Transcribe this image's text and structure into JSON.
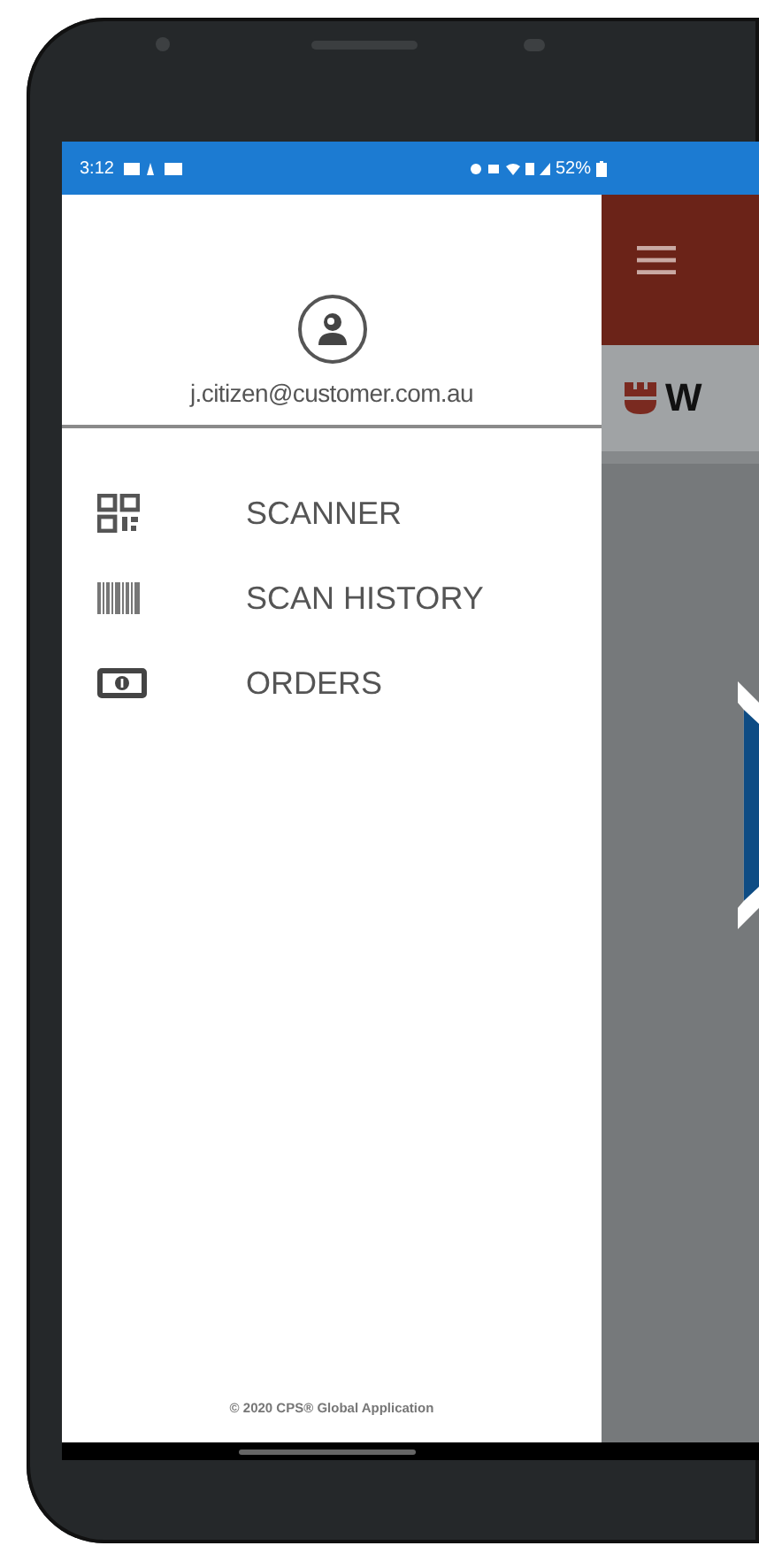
{
  "status_bar": {
    "time": "3:12",
    "battery": "52%"
  },
  "drawer": {
    "email": "j.citizen@customer.com.au",
    "items": [
      {
        "kind": "qr",
        "label": "SCANNER",
        "selected": false
      },
      {
        "kind": "barcode",
        "label": "SCAN HISTORY",
        "selected": false
      },
      {
        "kind": "money",
        "label": "ORDERS",
        "selected": false
      }
    ],
    "footer": "© 2020 CPS® Global Application"
  },
  "app_bar": {
    "logo_text": "W"
  }
}
